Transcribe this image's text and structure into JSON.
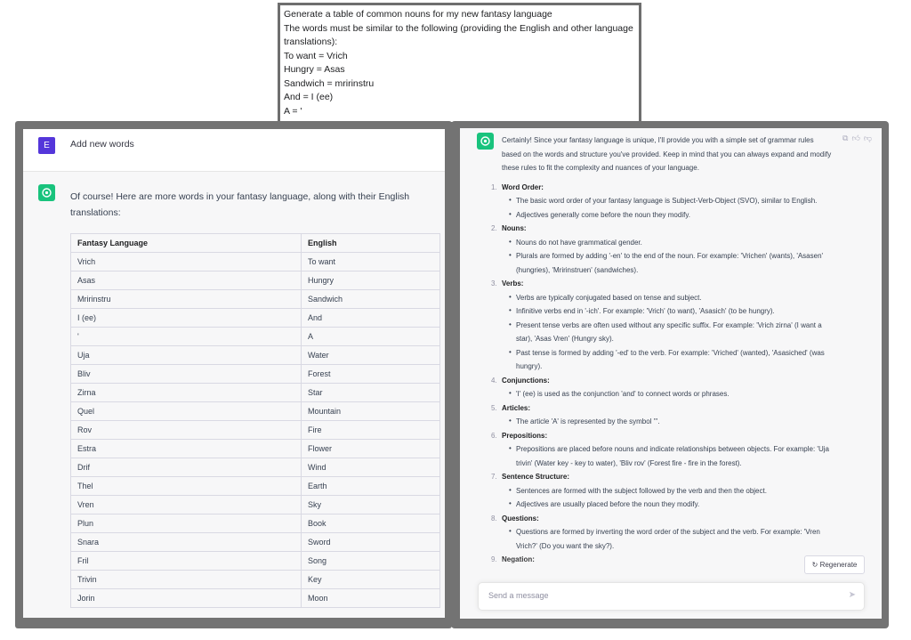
{
  "prompt": {
    "lines": [
      "Generate a table of common nouns for my new fantasy language",
      "The words must be similar to the following (providing the English and other language",
      "translations):",
      "To want = Vrich",
      "Hungry = Asas",
      "Sandwich = mririnstru",
      "And = I (ee)",
      "A = '"
    ]
  },
  "left": {
    "user_avatar_letter": "E",
    "user_message": "Add new words",
    "assistant_intro": "Of course! Here are more words in your fantasy language, along with their English translations:",
    "table": {
      "headers": [
        "Fantasy Language",
        "English"
      ],
      "rows": [
        [
          "Vrich",
          "To want"
        ],
        [
          "Asas",
          "Hungry"
        ],
        [
          "Mririnstru",
          "Sandwich"
        ],
        [
          "I (ee)",
          "And"
        ],
        [
          "'",
          "A"
        ],
        [
          "Uja",
          "Water"
        ],
        [
          "Bliv",
          "Forest"
        ],
        [
          "Zirna",
          "Star"
        ],
        [
          "Quel",
          "Mountain"
        ],
        [
          "Rov",
          "Fire"
        ],
        [
          "Estra",
          "Flower"
        ],
        [
          "Drif",
          "Wind"
        ],
        [
          "Thel",
          "Earth"
        ],
        [
          "Vren",
          "Sky"
        ],
        [
          "Plun",
          "Book"
        ],
        [
          "Snara",
          "Sword"
        ],
        [
          "Fril",
          "Song"
        ],
        [
          "Trivin",
          "Key"
        ],
        [
          "Jorin",
          "Moon"
        ]
      ]
    }
  },
  "right": {
    "intro": "Certainly! Since your fantasy language is unique, I'll provide you with a simple set of grammar rules based on the words and structure you've provided. Keep in mind that you can always expand and modify these rules to fit the complexity and nuances of your language.",
    "rules": [
      {
        "num": "1.",
        "title": "Word Order:",
        "bullets": [
          "The basic word order of your fantasy language is Subject-Verb-Object (SVO), similar to English.",
          "Adjectives generally come before the noun they modify."
        ]
      },
      {
        "num": "2.",
        "title": "Nouns:",
        "bullets": [
          "Nouns do not have grammatical gender.",
          "Plurals are formed by adding '-en' to the end of the noun. For example: 'Vrichen' (wants), 'Asasen' (hungries), 'Mririnstruen' (sandwiches)."
        ]
      },
      {
        "num": "3.",
        "title": "Verbs:",
        "bullets": [
          "Verbs are typically conjugated based on tense and subject.",
          "Infinitive verbs end in '-ich'. For example: 'Vrich' (to want), 'Asasich' (to be hungry).",
          "Present tense verbs are often used without any specific suffix. For example: 'Vrich zirna' (I want a star), 'Asas Vren' (Hungry sky).",
          "Past tense is formed by adding '-ed' to the verb. For example: 'Vriched' (wanted), 'Asasiched' (was hungry)."
        ]
      },
      {
        "num": "4.",
        "title": "Conjunctions:",
        "bullets": [
          "'I' (ee) is used as the conjunction 'and' to connect words or phrases."
        ]
      },
      {
        "num": "5.",
        "title": "Articles:",
        "bullets": [
          "The article 'A' is represented by the symbol '''."
        ]
      },
      {
        "num": "6.",
        "title": "Prepositions:",
        "bullets": [
          "Prepositions are placed before nouns and indicate relationships between objects. For example: 'Uja trivin' (Water key - key to water), 'Bliv rov' (Forest fire - fire in the forest)."
        ]
      },
      {
        "num": "7.",
        "title": "Sentence Structure:",
        "bullets": [
          "Sentences are formed with the subject followed by the verb and then the object.",
          "Adjectives are usually placed before the noun they modify."
        ]
      },
      {
        "num": "8.",
        "title": "Questions:",
        "bullets": [
          "Questions are formed by inverting the word order of the subject and the verb. For example: 'Vren Vrich?' (Do you want the sky?)."
        ]
      },
      {
        "num": "9.",
        "title": "Negation:",
        "bullets": []
      }
    ],
    "regenerate_label": "Regenerate",
    "regenerate_icon": "refresh-icon",
    "send_placeholder": "Send a message",
    "send_icon": "paper-plane-icon",
    "action_icons": [
      "copy-icon",
      "thumbs-up-icon",
      "thumbs-down-icon"
    ]
  },
  "colors": {
    "user_avatar": "#5436da",
    "assistant_logo": "#19c37d",
    "frame": "#737373"
  }
}
